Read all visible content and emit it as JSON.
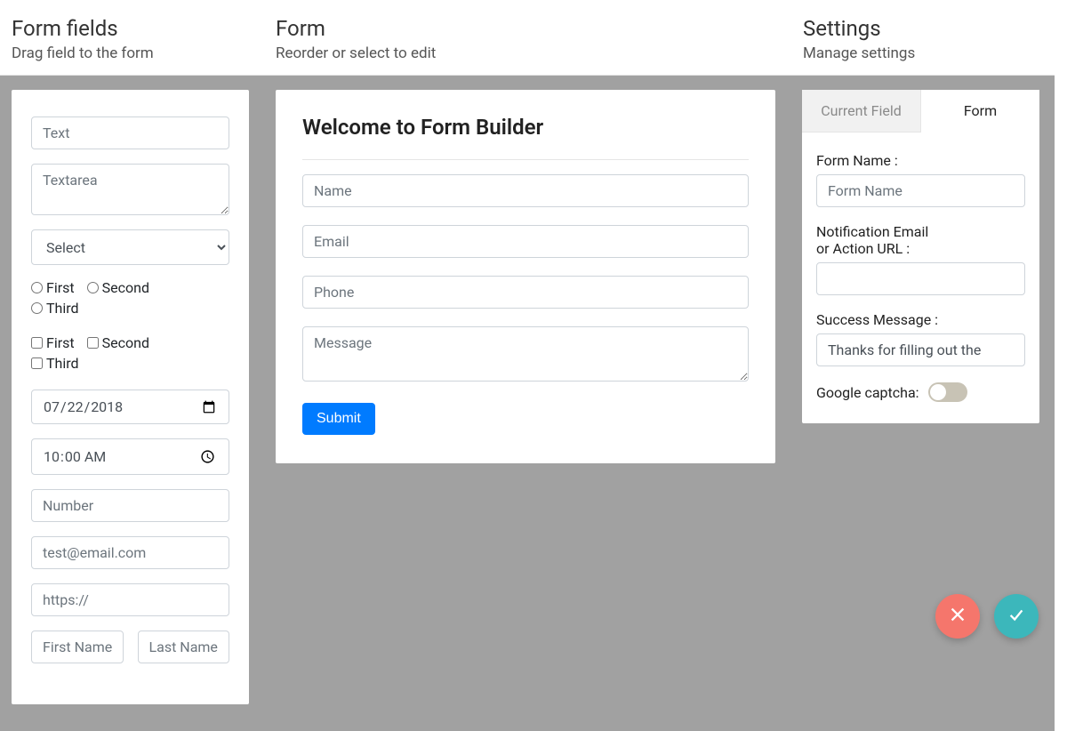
{
  "header": {
    "fields": {
      "title": "Form fields",
      "subtitle": "Drag field to the form"
    },
    "form": {
      "title": "Form",
      "subtitle": "Reorder or select to edit"
    },
    "settings": {
      "title": "Settings",
      "subtitle": "Manage settings"
    }
  },
  "palette": {
    "text_placeholder": "Text",
    "textarea_placeholder": "Textarea",
    "select_option": "Select",
    "radios": [
      "First",
      "Second",
      "Third"
    ],
    "checks": [
      "First",
      "Second",
      "Third"
    ],
    "date_value": "2018-07-22",
    "time_value": "10:00",
    "number_placeholder": "Number",
    "email_placeholder": "test@email.com",
    "url_placeholder": "https://",
    "name": {
      "first_placeholder": "First Name",
      "last_placeholder": "Last Name"
    }
  },
  "builder": {
    "title": "Welcome to Form Builder",
    "fields": {
      "name_placeholder": "Name",
      "email_placeholder": "Email",
      "phone_placeholder": "Phone",
      "message_placeholder": "Message"
    },
    "submit_label": "Submit"
  },
  "settings": {
    "tabs": {
      "current_field": "Current Field",
      "form": "Form",
      "active": "form"
    },
    "form_name_label": "Form Name :",
    "form_name_placeholder": "Form Name",
    "notification_label_line1": "Notification Email",
    "notification_label_line2": "or Action URL :",
    "notification_value": "",
    "success_label": "Success Message :",
    "success_value": "Thanks for filling out the",
    "captcha_label": "Google captcha:",
    "captcha_on": false
  },
  "fabs": {
    "cancel_name": "cancel",
    "confirm_name": "confirm"
  }
}
